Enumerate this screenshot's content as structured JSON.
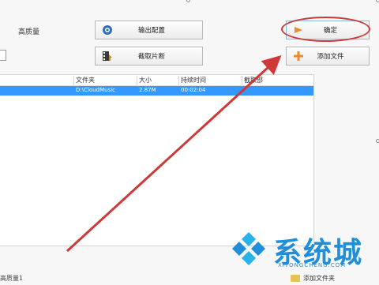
{
  "settings": {
    "quality_label": "高质量"
  },
  "toolbar": {
    "output_config_label": "输出配置",
    "clip_label": "截取片断",
    "confirm_label": "确定",
    "add_file_label": "添加文件"
  },
  "table": {
    "columns": [
      "文件夹",
      "大小",
      "持续时间",
      "截取部"
    ],
    "rows": [
      {
        "folder": "D:\\CloudMusic",
        "size": "2.87M",
        "duration": "00:02:04"
      }
    ]
  },
  "footer": {
    "status": "高质量1",
    "add_folder_label": "添加文件夹"
  },
  "watermark": {
    "brand": "系统城",
    "domain": "XITONGCHENG.COM"
  },
  "colors": {
    "accent": "#3399ff",
    "annotation": "#d03838",
    "watermark": "#1e8fd8"
  }
}
